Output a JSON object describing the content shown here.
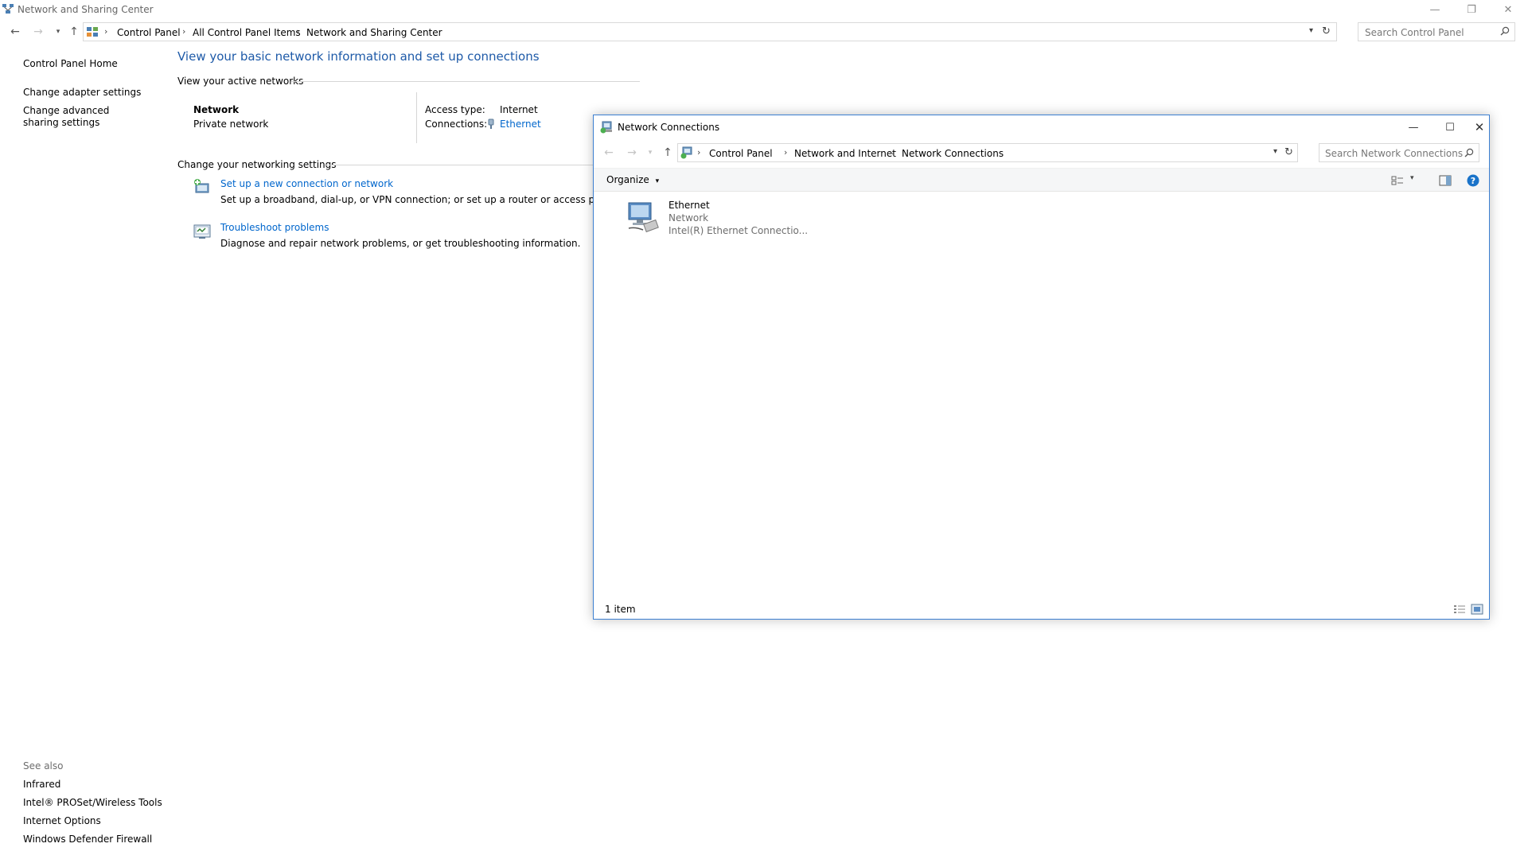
{
  "main_window": {
    "title": "Network and Sharing Center",
    "breadcrumb": [
      "Control Panel",
      "All Control Panel Items",
      "Network and Sharing Center"
    ],
    "search_placeholder": "Search Control Panel"
  },
  "left_pane": {
    "home": "Control Panel Home",
    "links": [
      "Change adapter settings",
      "Change advanced sharing settings"
    ],
    "see_also_heading": "See also",
    "see_also": [
      "Infrared",
      "Intel® PROSet/Wireless Tools",
      "Internet Options",
      "Windows Defender Firewall"
    ]
  },
  "content": {
    "heading": "View your basic network information and set up connections",
    "active_networks_label": "View your active networks",
    "network_name": "Network",
    "network_type": "Private network",
    "access_type_label": "Access type:",
    "access_type_value": "Internet",
    "connections_label": "Connections:",
    "connections_value": "Ethernet",
    "change_settings_label": "Change your networking settings",
    "tasks": [
      {
        "title": "Set up a new connection or network",
        "desc": "Set up a broadband, dial-up, or VPN connection; or set up a router or access point."
      },
      {
        "title": "Troubleshoot problems",
        "desc": "Diagnose and repair network problems, or get troubleshooting information."
      }
    ]
  },
  "nc_window": {
    "title": "Network Connections",
    "breadcrumb": [
      "Control Panel",
      "Network and Internet",
      "Network Connections"
    ],
    "search_placeholder": "Search Network Connections",
    "organize_label": "Organize",
    "item": {
      "name": "Ethernet",
      "network": "Network",
      "adapter": "Intel(R) Ethernet Connectio..."
    },
    "status": "1 item"
  },
  "colors": {
    "link": "#0066cc",
    "heading": "#1e5aa8",
    "window_border": "#3c7fd1"
  }
}
